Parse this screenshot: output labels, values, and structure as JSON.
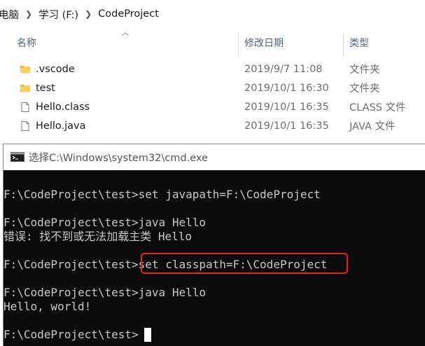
{
  "explorer": {
    "breadcrumb": [
      "电脑",
      "学习 (F:)",
      "CodeProject"
    ],
    "columns": {
      "name": "名称",
      "date": "修改日期",
      "type": "类型"
    },
    "files": [
      {
        "name": ".vscode",
        "date": "2019/9/7 11:08",
        "type": "文件夹",
        "icon": "folder-icon"
      },
      {
        "name": "test",
        "date": "2019/10/1 16:30",
        "type": "文件夹",
        "icon": "folder-icon"
      },
      {
        "name": "Hello.class",
        "date": "2019/10/1 16:35",
        "type": "CLASS 文件",
        "icon": "file-icon"
      },
      {
        "name": "Hello.java",
        "date": "2019/10/1 16:35",
        "type": "JAVA 文件",
        "icon": "file-icon"
      }
    ]
  },
  "cmd": {
    "title": "选择C:\\Windows\\system32\\cmd.exe",
    "lines": [
      "F:\\CodeProject\\test>set javapath=F:\\CodeProject",
      "",
      "F:\\CodeProject\\test>java Hello",
      "错误: 找不到或无法加载主类 Hello",
      "",
      "F:\\CodeProject\\test>set classpath=F:\\CodeProject",
      "",
      "F:\\CodeProject\\test>java Hello",
      "Hello, world!",
      "",
      "F:\\CodeProject\\test>"
    ],
    "highlight_color": "#e0242b"
  }
}
